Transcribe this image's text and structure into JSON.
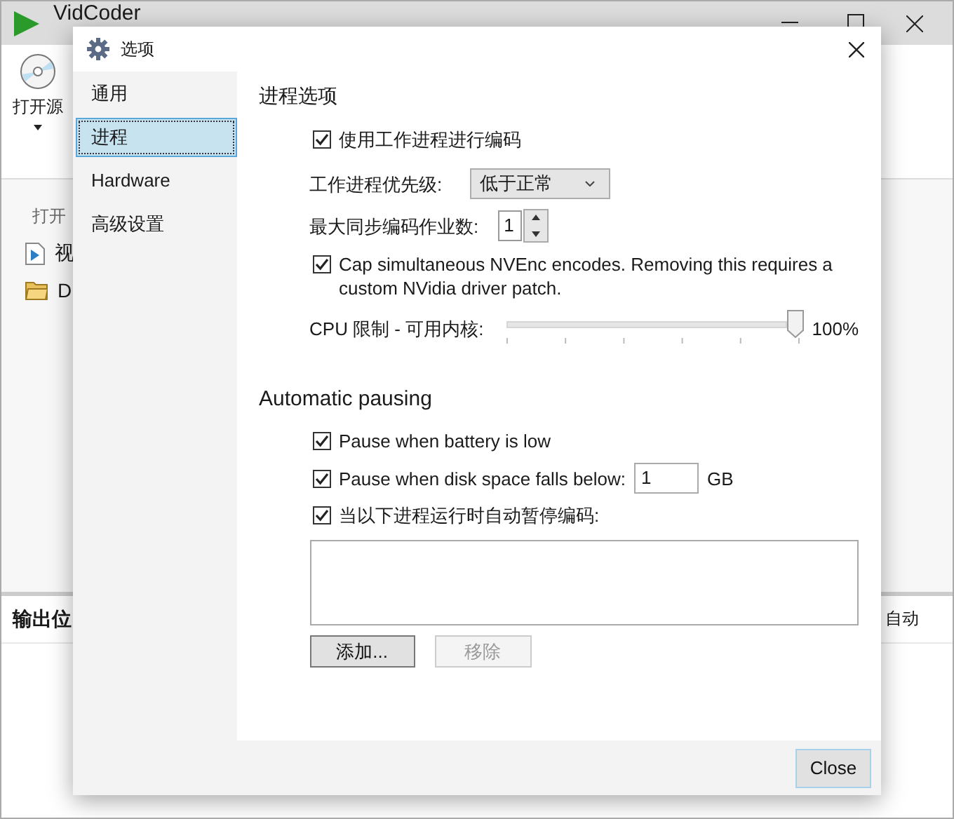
{
  "app": {
    "title": "VidCoder",
    "open_source_label": "打开源",
    "recent_heading": "打开",
    "recent_items": [
      {
        "kind": "video",
        "label": "视"
      },
      {
        "kind": "folder",
        "label": "D"
      }
    ],
    "output_label": "输出位",
    "output_value": "自动"
  },
  "dialog": {
    "title": "选项",
    "nav": [
      {
        "label": "通用",
        "selected": false
      },
      {
        "label": "进程",
        "selected": true
      },
      {
        "label": "Hardware",
        "selected": false
      },
      {
        "label": "高级设置",
        "selected": false
      }
    ],
    "process_options": {
      "title": "进程选项",
      "rows": [
        {
          "kind": "checkbox",
          "label": "使用工作进程进行编码",
          "checked": true
        },
        {
          "kind": "dropdown",
          "label": "工作进程优先级:",
          "value": "低于正常"
        },
        {
          "kind": "spinner",
          "label": "最大同步编码作业数:",
          "value": "1"
        },
        {
          "kind": "checkbox",
          "label": "Cap simultaneous NVEnc encodes. Removing this requires a custom NVidia driver patch.",
          "checked": true
        },
        {
          "kind": "slider",
          "label": "CPU 限制 - 可用内核:",
          "level": 1.0,
          "reading": "100%"
        }
      ]
    },
    "automatic_pausing": {
      "title": "Automatic pausing",
      "rows": [
        {
          "kind": "checkbox",
          "label": "Pause when battery is low",
          "checked": true
        },
        {
          "kind": "checkbox_field",
          "label": "Pause when disk space falls below:",
          "checked": true,
          "value": "1",
          "unit": "GB"
        },
        {
          "kind": "checkbox",
          "label": "当以下进程运行时自动暂停编码:",
          "checked": true
        }
      ],
      "buttons": [
        {
          "label": "添加...",
          "disabled": false
        },
        {
          "label": "移除",
          "disabled": true
        }
      ]
    },
    "close_button": "Close"
  }
}
